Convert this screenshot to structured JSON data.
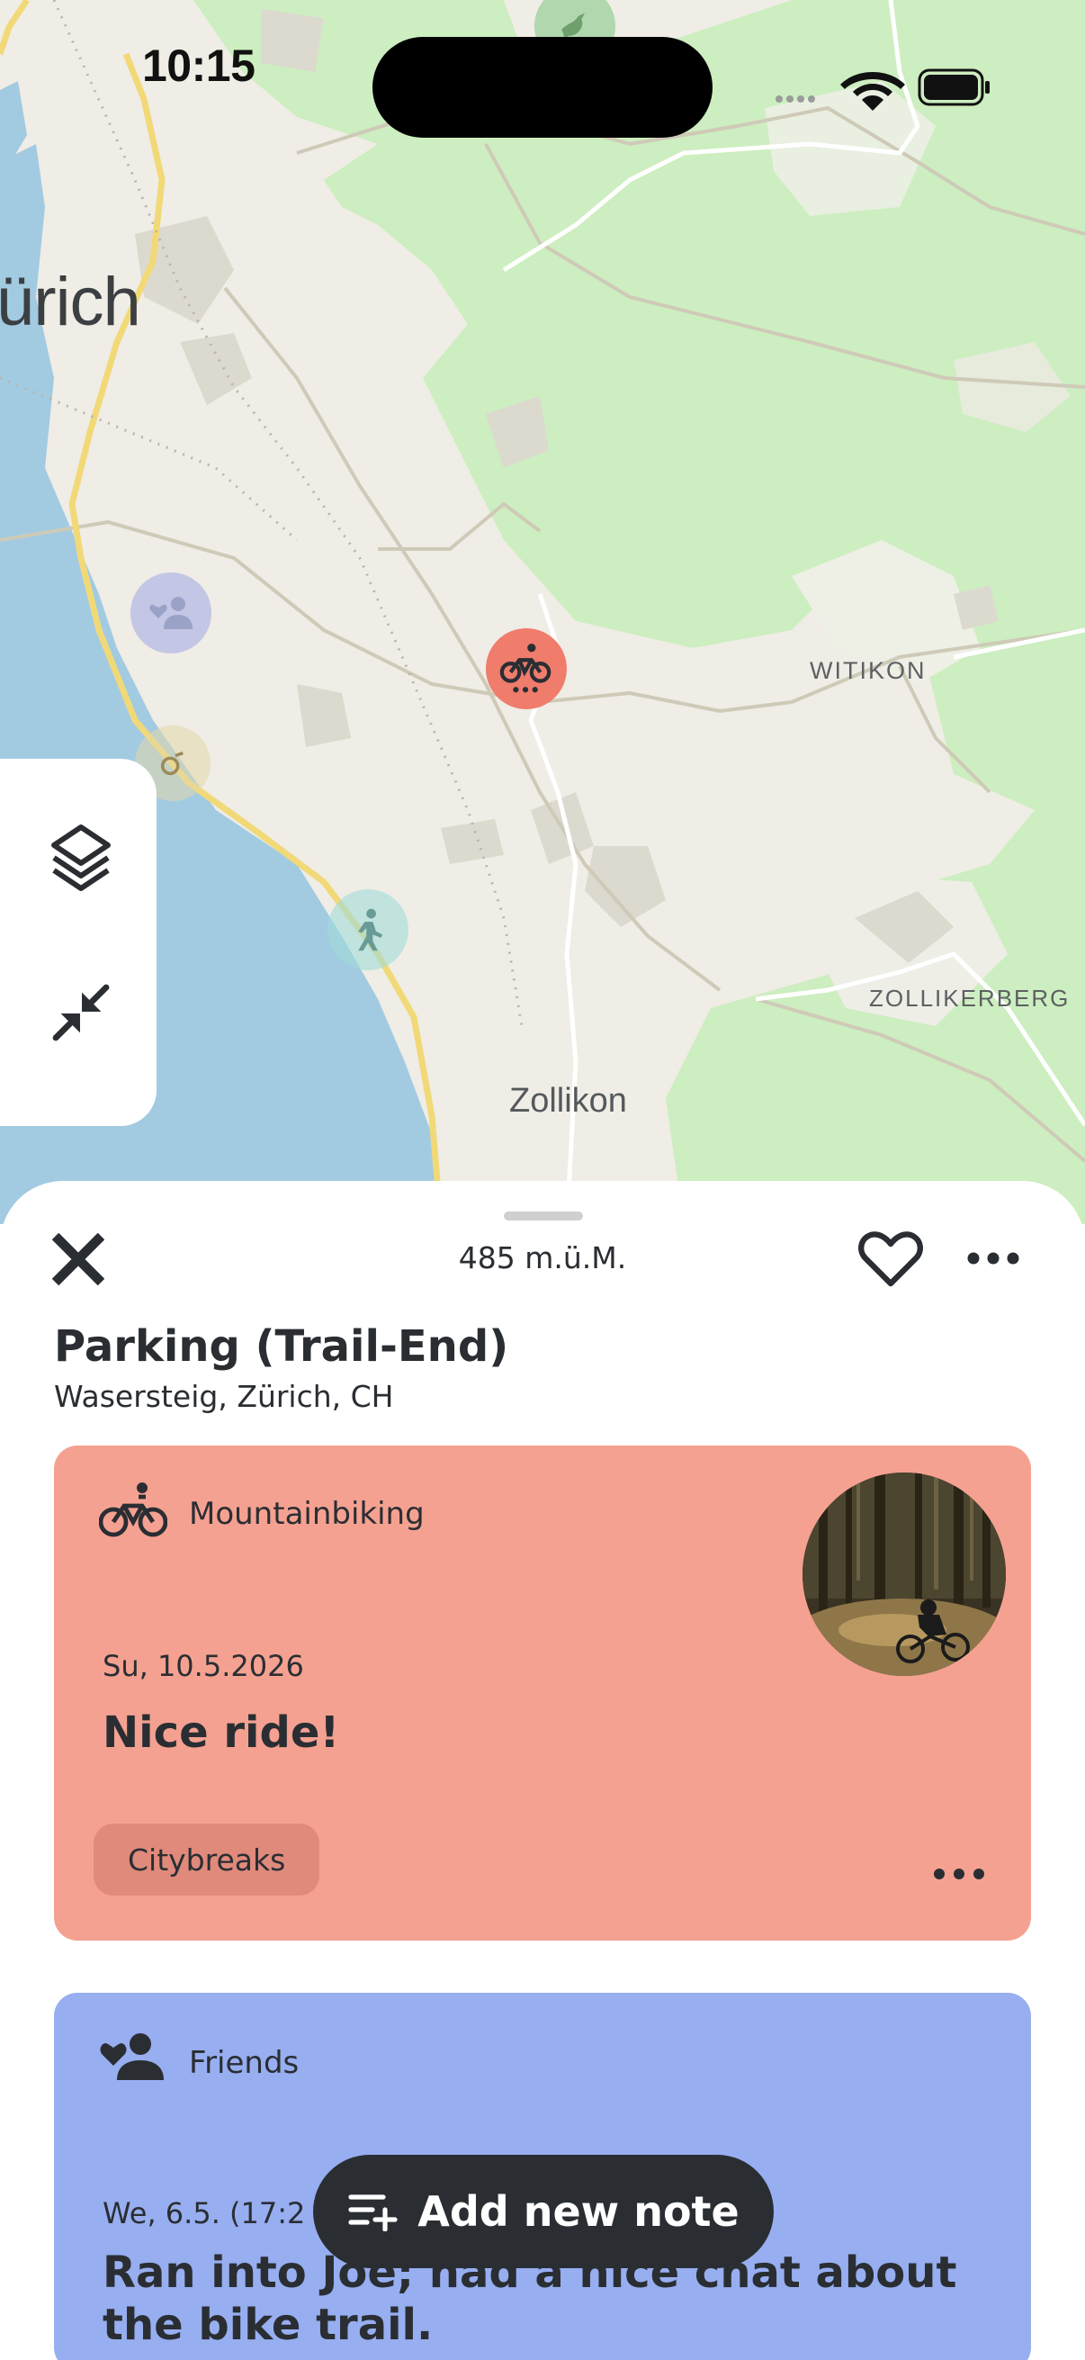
{
  "status_bar": {
    "time": "10:15"
  },
  "map": {
    "labels": {
      "city": "ürich",
      "district_1": "WITIKON",
      "district_2": "ZOLLIKERBERG",
      "town": "Zollikon"
    },
    "pins": {
      "active_category": "mountainbiking-icon",
      "colors": {
        "active": "#f07c6c",
        "social": "#a0a5e6",
        "hike": "#a0dcd7"
      }
    },
    "colors": {
      "water": "#a2cbe2",
      "forest": "#cdeec0",
      "land": "#efede5"
    }
  },
  "map_controls": {
    "layers": "layers-icon",
    "collapse": "collapse-icon"
  },
  "sheet": {
    "altitude": "485 m.ü.M.",
    "place": {
      "title": "Parking (Trail-End)",
      "address": "Wasersteig, Zürich, CH"
    },
    "notes": [
      {
        "category": "Mountainbiking",
        "category_icon": "mountainbike-icon",
        "date": "Su, 10.5.2026",
        "text": "Nice ride!",
        "tag": "Citybreaks",
        "color": "#f5a191"
      },
      {
        "category": "Friends",
        "category_icon": "friends-icon",
        "date": "We, 6.5. (17:2",
        "text": "Ran into Joe; had a nice chat about the bike trail.",
        "color": "#97aef0"
      }
    ]
  },
  "fab": {
    "label": "Add new note"
  }
}
